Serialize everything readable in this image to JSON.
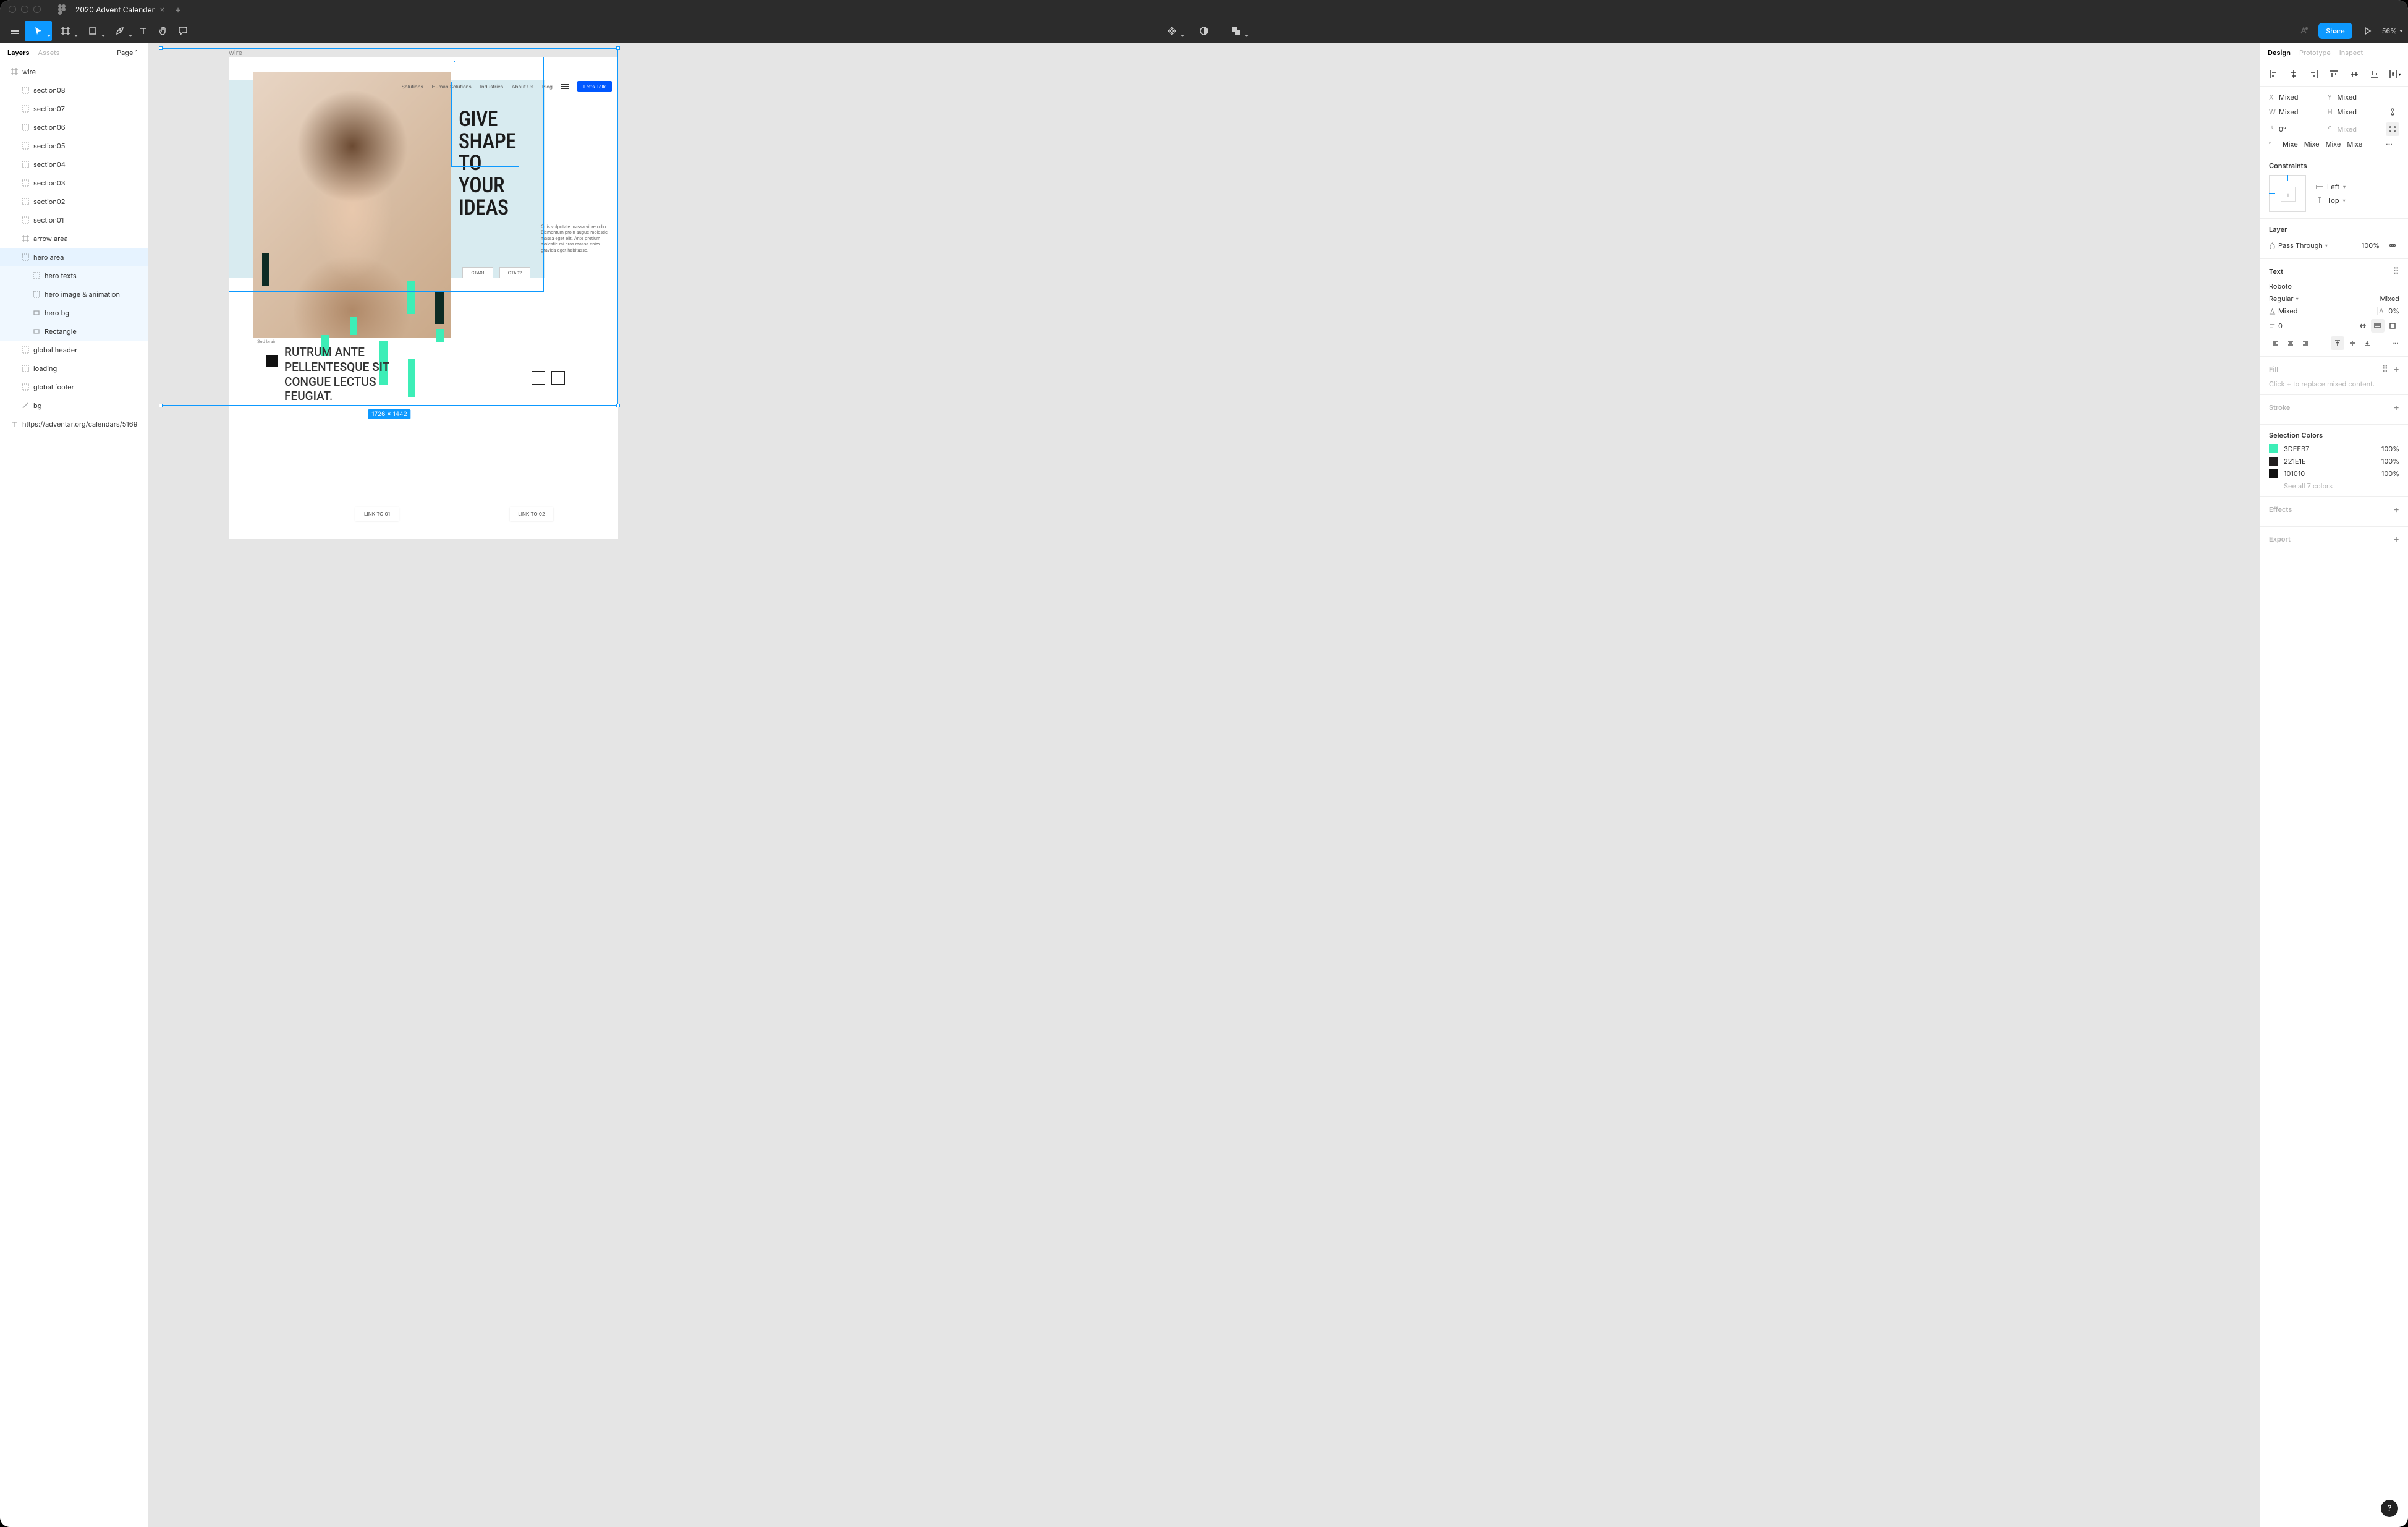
{
  "file": {
    "name": "2020 Advent Calender"
  },
  "toolbar": {
    "share": "Share",
    "zoom": "56%"
  },
  "leftPanel": {
    "tabs": {
      "layers": "Layers",
      "assets": "Assets"
    },
    "page": "Page 1",
    "layers": [
      {
        "name": "wire",
        "icon": "frame",
        "pad": 0
      },
      {
        "name": "section08",
        "icon": "group",
        "pad": 1
      },
      {
        "name": "section07",
        "icon": "group",
        "pad": 1
      },
      {
        "name": "section06",
        "icon": "group",
        "pad": 1
      },
      {
        "name": "section05",
        "icon": "group",
        "pad": 1
      },
      {
        "name": "section04",
        "icon": "group",
        "pad": 1
      },
      {
        "name": "section03",
        "icon": "group",
        "pad": 1
      },
      {
        "name": "section02",
        "icon": "group",
        "pad": 1
      },
      {
        "name": "section01",
        "icon": "group",
        "pad": 1
      },
      {
        "name": "arrow area",
        "icon": "frame",
        "pad": 1
      },
      {
        "name": "hero area",
        "icon": "group",
        "pad": 1,
        "sel": true
      },
      {
        "name": "hero texts",
        "icon": "group",
        "pad": 2,
        "child": true
      },
      {
        "name": "hero image & animation",
        "icon": "group",
        "pad": 2,
        "child": true
      },
      {
        "name": "hero bg",
        "icon": "rect",
        "pad": 2,
        "child": true
      },
      {
        "name": "Rectangle",
        "icon": "rect",
        "pad": 2,
        "child": true
      },
      {
        "name": "global header",
        "icon": "group",
        "pad": 1
      },
      {
        "name": "loading",
        "icon": "group",
        "pad": 1
      },
      {
        "name": "global footer",
        "icon": "group",
        "pad": 1
      },
      {
        "name": "bg",
        "icon": "line",
        "pad": 1
      },
      {
        "name": "https://adventar.org/calendars/5169",
        "icon": "text",
        "pad": 0
      }
    ]
  },
  "rightPanel": {
    "tabs": {
      "design": "Design",
      "prototype": "Prototype",
      "inspect": "Inspect"
    },
    "transform": {
      "x": "Mixed",
      "y": "Mixed",
      "w": "Mixed",
      "h": "Mixed",
      "rotation": "0°",
      "radius": "Mixed",
      "r1": "Mixe",
      "r2": "Mixe",
      "r3": "Mixe",
      "r4": "Mixe"
    },
    "constraints": {
      "title": "Constraints",
      "horiz": "Left",
      "vert": "Top"
    },
    "layer": {
      "title": "Layer",
      "blend": "Pass Through",
      "opacity": "100%"
    },
    "text": {
      "title": "Text",
      "font": "Roboto",
      "weight": "Regular",
      "size": "Mixed",
      "lineHeight": "Mixed",
      "letter": "0%",
      "para": "0"
    },
    "fill": {
      "title": "Fill",
      "hint": "Click + to replace mixed content."
    },
    "stroke": {
      "title": "Stroke"
    },
    "selectionColors": {
      "title": "Selection Colors",
      "items": [
        {
          "hex": "3DEEB7",
          "pct": "100%",
          "swatch": "#3DEEB7"
        },
        {
          "hex": "221E1E",
          "pct": "100%",
          "swatch": "#221E1E"
        },
        {
          "hex": "101010",
          "pct": "100%",
          "swatch": "#101010"
        }
      ],
      "seeAll": "See all 7 colors"
    },
    "effects": {
      "title": "Effects"
    },
    "export": {
      "title": "Export"
    }
  },
  "canvas": {
    "frameLabel": "wire",
    "dimBadge": "1726 × 1442",
    "nav": [
      "Solutions",
      "Human Solutions",
      "Industries",
      "About Us",
      "Blog"
    ],
    "letsTalk": "Let's Talk",
    "heroTitle": "GIVE\nSHAPE\nTO\nYOUR\nIDEAS",
    "lorem": "Quis vulputate massa vitae odio. Elementum proin augue molestie massa eget elit. Ante pretium molestie mi cras massa enim gravida eget habitasse.",
    "cta1": "CTA01",
    "cta2": "CTA02",
    "subhead": "RUTRUM ANTE\nPELLENTESQUE SIT\nCONGUE LECTUS\nFEUGIAT.",
    "smallLabel": "Sed brain",
    "link1": "LINK TO 01",
    "link2": "LINK TO 02"
  }
}
